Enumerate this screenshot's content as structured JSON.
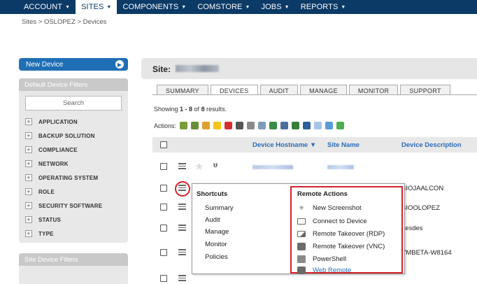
{
  "nav": {
    "items": [
      {
        "label": "ACCOUNT",
        "active": false
      },
      {
        "label": "SITES",
        "active": true
      },
      {
        "label": "COMPONENTS",
        "active": false
      },
      {
        "label": "COMSTORE",
        "active": false
      },
      {
        "label": "JOBS",
        "active": false
      },
      {
        "label": "REPORTS",
        "active": false
      }
    ],
    "caret": "▼"
  },
  "breadcrumb": "Sites > OSLOPEZ > Devices",
  "sidebar": {
    "new_device_label": "New Device",
    "default_filters_title": "Default Device Filters",
    "search_placeholder": "Search",
    "filters": [
      "APPLICATION",
      "BACKUP SOLUTION",
      "COMPLIANCE",
      "NETWORK",
      "OPERATING SYSTEM",
      "ROLE",
      "SECURITY SOFTWARE",
      "STATUS",
      "TYPE"
    ],
    "site_filters_title": "Site Device Filters"
  },
  "main": {
    "site_label": "Site:",
    "tabs": [
      "SUMMARY",
      "DEVICES",
      "AUDIT",
      "MANAGE",
      "MONITOR",
      "SUPPORT"
    ],
    "active_tab": "DEVICES",
    "showing_prefix": "Showing ",
    "showing_range": "1 - 8",
    "showing_of": " of ",
    "showing_total": "8",
    "showing_suffix": " results.",
    "actions_label": "Actions:",
    "columns": {
      "hostname": "Device Hostname ▼",
      "site_name": "Site Name",
      "description": "Device Description"
    },
    "rows": [
      {
        "description": ""
      },
      {
        "description": "BIOJAALCON"
      },
      {
        "description": "BIOOLOPEZ"
      },
      {
        "description": "desdes"
      },
      {
        "description": "VMBETA-W8164"
      },
      {
        "description": ""
      }
    ]
  },
  "popup": {
    "shortcuts_title": "Shortcuts",
    "shortcuts": [
      "Summary",
      "Audit",
      "Manage",
      "Monitor",
      "Policies"
    ],
    "remote_title": "Remote Actions",
    "remote_actions": [
      "New Screenshot",
      "Connect to Device",
      "Remote Takeover (RDP)",
      "Remote Takeover (VNC)",
      "PowerShell",
      "Web Remote"
    ]
  }
}
